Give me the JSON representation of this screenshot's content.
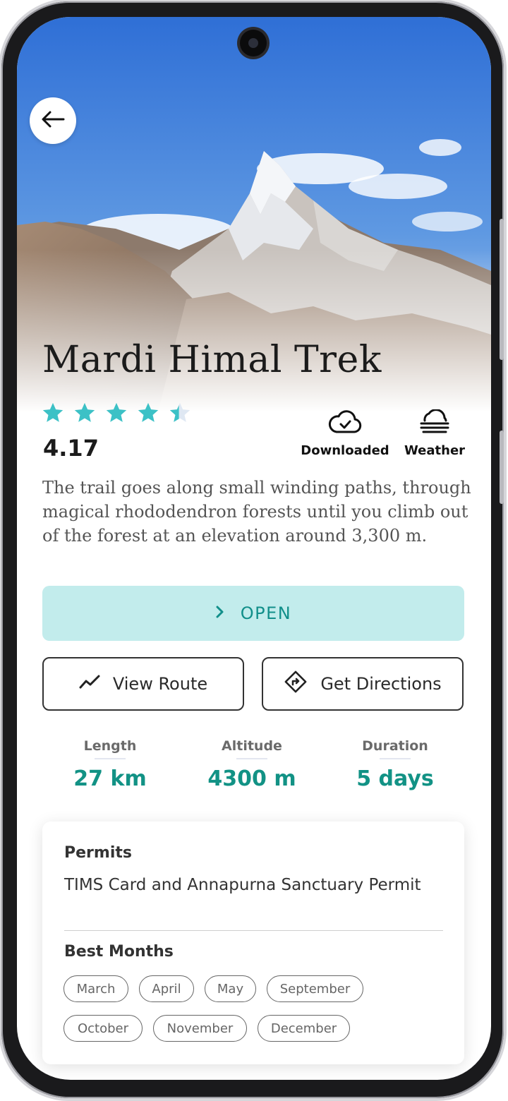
{
  "trek": {
    "title": "Mardi Himal Trek",
    "rating": "4.17",
    "rating_value": 4.17,
    "description": "The trail goes along small winding paths, through magical rhododendron forests until you climb out of the forest at an elevation around 3,300 m."
  },
  "actions": {
    "downloaded": "Downloaded",
    "weather": "Weather"
  },
  "buttons": {
    "open": "OPEN",
    "view_route": "View Route",
    "get_directions": "Get Directions"
  },
  "stats": [
    {
      "label": "Length",
      "value": "27 km"
    },
    {
      "label": "Altitude",
      "value": "4300 m"
    },
    {
      "label": "Duration",
      "value": "5 days"
    }
  ],
  "info": {
    "permits_title": "Permits",
    "permits_text": "TIMS Card and Annapurna Sanctuary Permit",
    "months_title": "Best Months",
    "months": [
      "March",
      "April",
      "May",
      "September",
      "October",
      "November",
      "December"
    ]
  },
  "colors": {
    "accent": "#3cc1c6",
    "value": "#129285",
    "open_bg": "#c2ecec"
  },
  "icons": {
    "back": "arrow-left-icon",
    "downloaded": "cloud-check-icon",
    "weather": "fog-icon",
    "open": "chevron-right-icon",
    "route": "trend-line-icon",
    "directions": "directions-sign-icon"
  }
}
